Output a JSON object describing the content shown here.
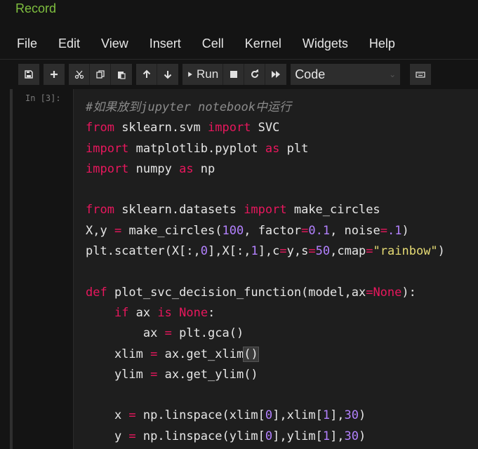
{
  "header": {
    "notebook_name": "Record"
  },
  "menu": [
    "File",
    "Edit",
    "View",
    "Insert",
    "Cell",
    "Kernel",
    "Widgets",
    "Help"
  ],
  "toolbar": {
    "run_label": "Run",
    "cell_type": "Code"
  },
  "cell": {
    "prompt": "In [3]:",
    "code_lines": [
      "#如果放到jupyter notebook中运行",
      "from sklearn.svm import SVC",
      "import matplotlib.pyplot as plt",
      "import numpy as np",
      "",
      "from sklearn.datasets import make_circles",
      "X,y = make_circles(100, factor=0.1, noise=.1)",
      "plt.scatter(X[:,0],X[:,1],c=y,s=50,cmap=\"rainbow\")",
      "",
      "def plot_svc_decision_function(model,ax=None):",
      "    if ax is None:",
      "        ax = plt.gca()",
      "    xlim = ax.get_xlim()",
      "    ylim = ax.get_ylim()",
      "",
      "    x = np.linspace(xlim[0],xlim[1],30)",
      "    y = np.linspace(ylim[0],ylim[1],30)"
    ]
  },
  "colors": {
    "keyword": "#e8175d",
    "comment": "#8a8a8a",
    "number": "#b381ff",
    "string": "#e6db74",
    "notebook_name": "#7fbf3f",
    "background": "#141414"
  }
}
